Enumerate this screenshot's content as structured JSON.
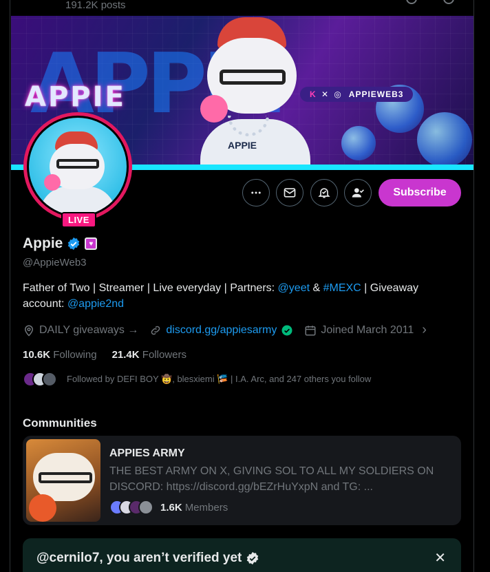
{
  "header": {
    "post_count": "191.2K posts"
  },
  "banner": {
    "big_text": "APPIE",
    "logo_text": "APPIE",
    "handle_badge": "APPIEWEB3",
    "shirt_text": "APPIE"
  },
  "profile": {
    "live_label": "LIVE",
    "name": "Appie",
    "handle": "@AppieWeb3",
    "subscribe_label": "Subscribe",
    "bio": {
      "part1": "Father of Two | Streamer | Live everyday | Partners: ",
      "mention1": "@yeet",
      "amp": " & ",
      "hashtag": "#MEXC",
      "part2": " | Giveaway account: ",
      "mention2": "@appie2nd"
    },
    "location": "DAILY giveaways →",
    "website": "discord.gg/appiesarmy",
    "joined": "Joined March 2011",
    "following_count": "10.6K",
    "following_label": "Following",
    "followers_count": "21.4K",
    "followers_label": "Followers",
    "followed_by": "Followed by DEFI BOY 🤠, blesxiemi 🎏 | I.A. Arc, and 247 others you follow"
  },
  "communities": {
    "title": "Communities",
    "card": {
      "name": "APPIES ARMY",
      "description": "THE BEST ARMY ON X, GIVING SOL TO ALL MY SOLDIERS ON DISCORD: https://discord.gg/bEZrHuYxpN and TG: ...",
      "members_count": "1.6K",
      "members_label": "Members"
    }
  },
  "verify_banner": {
    "text": "@cernilo7, you aren’t verified yet"
  },
  "colors": {
    "accent": "#1d9bf0",
    "subscribe": "#c936cf",
    "live": "#f91880",
    "verified": "#1d9bf0"
  }
}
